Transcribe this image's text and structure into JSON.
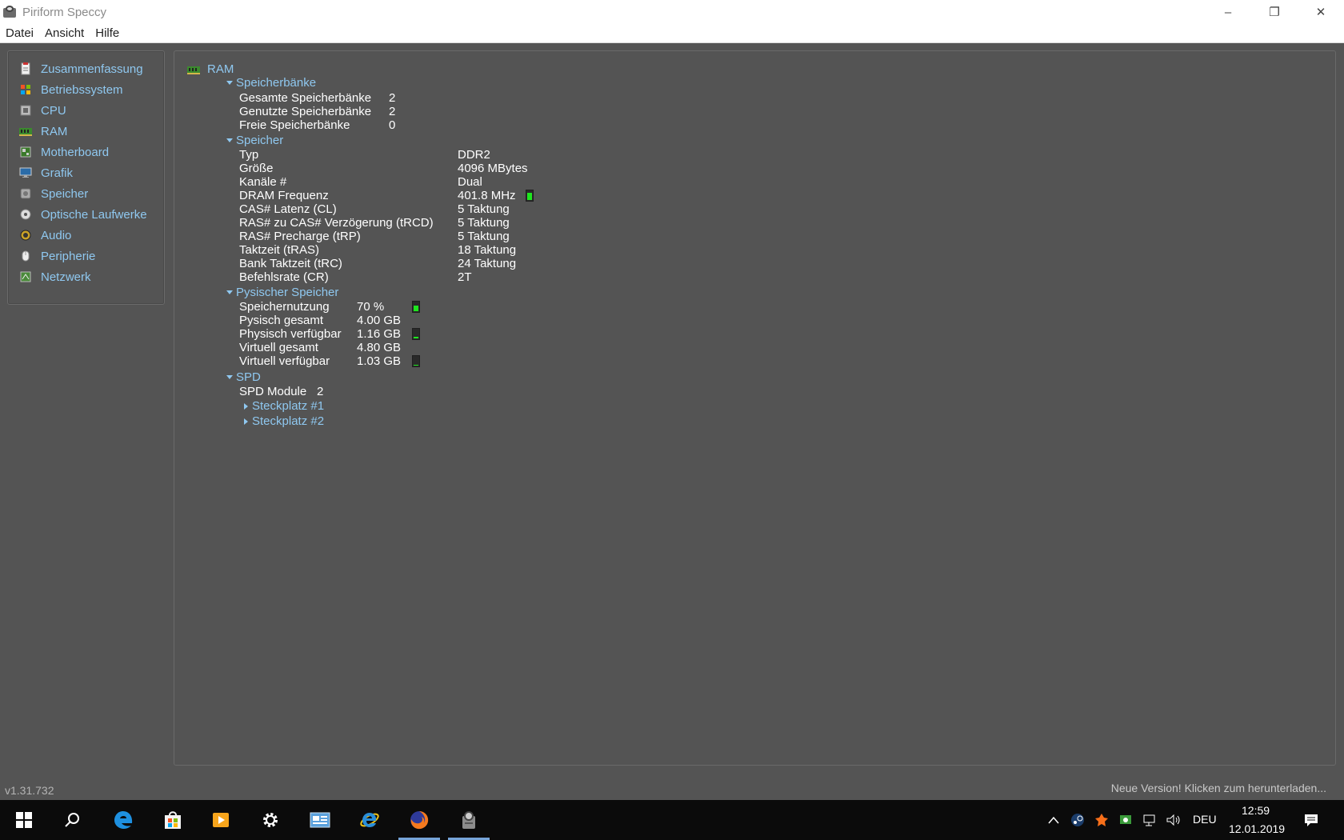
{
  "window": {
    "title": "Piriform Speccy",
    "minimize": "–",
    "maximize": "❐",
    "close": "✕"
  },
  "menu": [
    "Datei",
    "Ansicht",
    "Hilfe"
  ],
  "sidebar": {
    "items": [
      {
        "label": "Zusammenfassung",
        "icon": "summary-icon"
      },
      {
        "label": "Betriebssystem",
        "icon": "windows-icon"
      },
      {
        "label": "CPU",
        "icon": "cpu-icon"
      },
      {
        "label": "RAM",
        "icon": "ram-icon"
      },
      {
        "label": "Motherboard",
        "icon": "motherboard-icon"
      },
      {
        "label": "Grafik",
        "icon": "monitor-icon"
      },
      {
        "label": "Speicher",
        "icon": "harddrive-icon"
      },
      {
        "label": "Optische Laufwerke",
        "icon": "disc-icon"
      },
      {
        "label": "Audio",
        "icon": "speaker-icon"
      },
      {
        "label": "Peripherie",
        "icon": "mouse-icon"
      },
      {
        "label": "Netzwerk",
        "icon": "network-icon"
      }
    ]
  },
  "main": {
    "title": "RAM",
    "banks": {
      "header": "Speicherbänke",
      "rows": [
        {
          "label": "Gesamte Speicherbänke",
          "value": "2"
        },
        {
          "label": "Genutzte Speicherbänke",
          "value": "2"
        },
        {
          "label": "Freie Speicherbänke",
          "value": "0"
        }
      ]
    },
    "memory": {
      "header": "Speicher",
      "rows": [
        {
          "label": "Typ",
          "value": "DDR2"
        },
        {
          "label": "Größe",
          "value": "4096 MBytes"
        },
        {
          "label": "Kanäle #",
          "value": "Dual"
        },
        {
          "label": "DRAM Frequenz",
          "value": "401.8 MHz"
        },
        {
          "label": "CAS# Latenz (CL)",
          "value": "5 Taktung"
        },
        {
          "label": "RAS# zu CAS# Verzögerung (tRCD)",
          "value": "5 Taktung"
        },
        {
          "label": "RAS# Precharge (tRP)",
          "value": "5 Taktung"
        },
        {
          "label": "Taktzeit (tRAS)",
          "value": "18 Taktung"
        },
        {
          "label": "Bank Taktzeit (tRC)",
          "value": "24 Taktung"
        },
        {
          "label": "Befehlsrate (CR)",
          "value": "2T"
        }
      ]
    },
    "physical": {
      "header": "Pysischer Speicher",
      "rows": [
        {
          "label": "Speichernutzung",
          "value": "70 %"
        },
        {
          "label": "Pysisch gesamt",
          "value": "4.00 GB"
        },
        {
          "label": "Physisch verfügbar",
          "value": "1.16 GB"
        },
        {
          "label": "Virtuell gesamt",
          "value": "4.80 GB"
        },
        {
          "label": "Virtuell verfügbar",
          "value": "1.03 GB"
        }
      ]
    },
    "spd": {
      "header": "SPD",
      "modules_label": "SPD Module",
      "modules_value": "2",
      "slots": [
        "Steckplatz #1",
        "Steckplatz #2"
      ]
    }
  },
  "indicators": {
    "dram_frequency_level": 0.85,
    "memory_usage_level": 0.7,
    "physical_available_level": 0.3,
    "virtual_available_level": 0.25,
    "color": "#1ee61e"
  },
  "statusbar": {
    "version": "v1.31.732",
    "update": "Neue Version! Klicken zum herunterladen..."
  },
  "taskbar": {
    "apps": [
      "windows-start-icon",
      "search-icon",
      "edge-icon",
      "store-icon",
      "media-player-icon",
      "settings-icon",
      "control-panel-icon",
      "internet-explorer-icon",
      "firefox-icon",
      "speccy-icon"
    ],
    "language": "DEU",
    "time": "12:59",
    "date": "12.01.2019"
  }
}
